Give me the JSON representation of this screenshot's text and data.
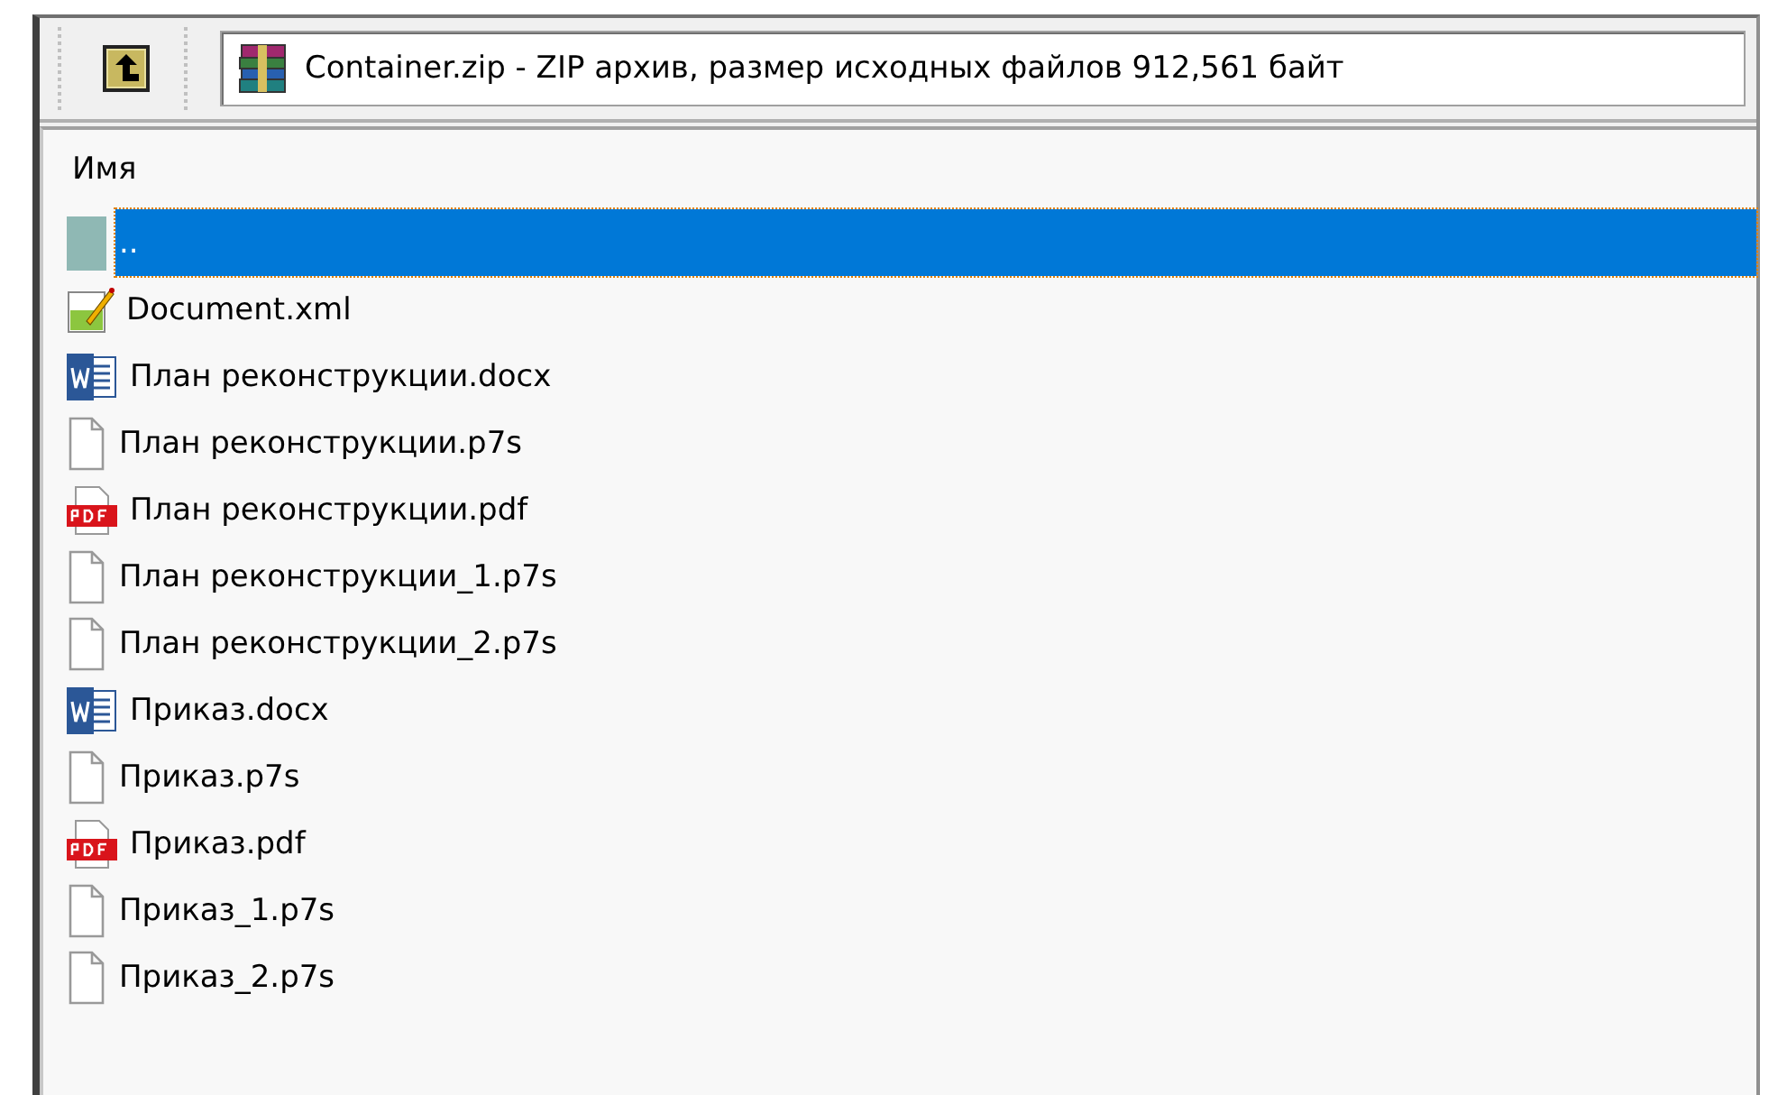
{
  "address": {
    "text": "Container.zip - ZIP архив, размер исходных файлов 912,561 байт"
  },
  "list": {
    "columns": [
      "Имя"
    ],
    "rows": [
      {
        "name": "..",
        "kind": "up",
        "selected": true
      },
      {
        "name": "Document.xml",
        "kind": "xml",
        "selected": false
      },
      {
        "name": "План реконструкции.docx",
        "kind": "word",
        "selected": false
      },
      {
        "name": "План реконструкции.p7s",
        "kind": "file",
        "selected": false
      },
      {
        "name": "План реконструкции.pdf",
        "kind": "pdf",
        "selected": false
      },
      {
        "name": "План реконструкции_1.p7s",
        "kind": "file",
        "selected": false
      },
      {
        "name": "План реконструкции_2.p7s",
        "kind": "file",
        "selected": false
      },
      {
        "name": "Приказ.docx",
        "kind": "word",
        "selected": false
      },
      {
        "name": "Приказ.p7s",
        "kind": "file",
        "selected": false
      },
      {
        "name": "Приказ.pdf",
        "kind": "pdf",
        "selected": false
      },
      {
        "name": "Приказ_1.p7s",
        "kind": "file",
        "selected": false
      },
      {
        "name": "Приказ_2.p7s",
        "kind": "file",
        "selected": false
      }
    ]
  }
}
